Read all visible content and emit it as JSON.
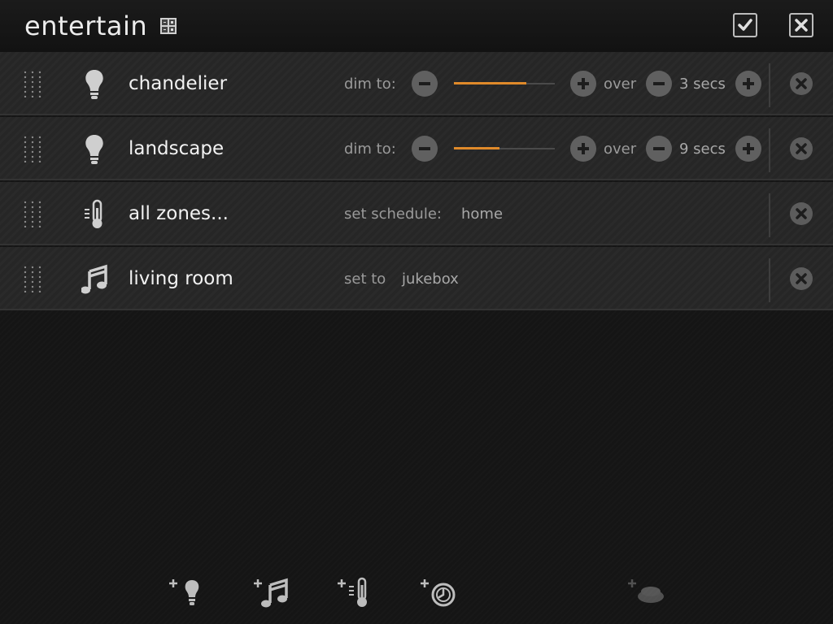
{
  "header": {
    "title": "entertain",
    "title_icon": "calculator-grid-icon",
    "confirm_icon": "checkmark-icon",
    "close_icon": "close-icon"
  },
  "rows": [
    {
      "name": "chandelier",
      "icon": "light-bulb-icon",
      "action_label": "dim to:",
      "level_fraction": 0.72,
      "over_label": "over",
      "duration": "3 secs"
    },
    {
      "name": "landscape",
      "icon": "light-bulb-icon",
      "action_label": "dim to:",
      "level_fraction": 0.45,
      "over_label": "over",
      "duration": "9 secs"
    },
    {
      "name": "all zones...",
      "icon": "thermometer-icon",
      "action_label": "set schedule:",
      "value": "home"
    },
    {
      "name": "living room",
      "icon": "music-note-icon",
      "action_label": "set to",
      "value": "jukebox"
    }
  ],
  "toolbar": [
    {
      "icon": "add-light-icon"
    },
    {
      "icon": "add-music-icon"
    },
    {
      "icon": "add-thermostat-icon"
    },
    {
      "icon": "add-timer-icon"
    },
    {
      "icon": "add-button-icon",
      "disabled": true
    }
  ],
  "colors": {
    "accent": "#e08a2a",
    "background": "#151515",
    "row_background": "#262626"
  }
}
